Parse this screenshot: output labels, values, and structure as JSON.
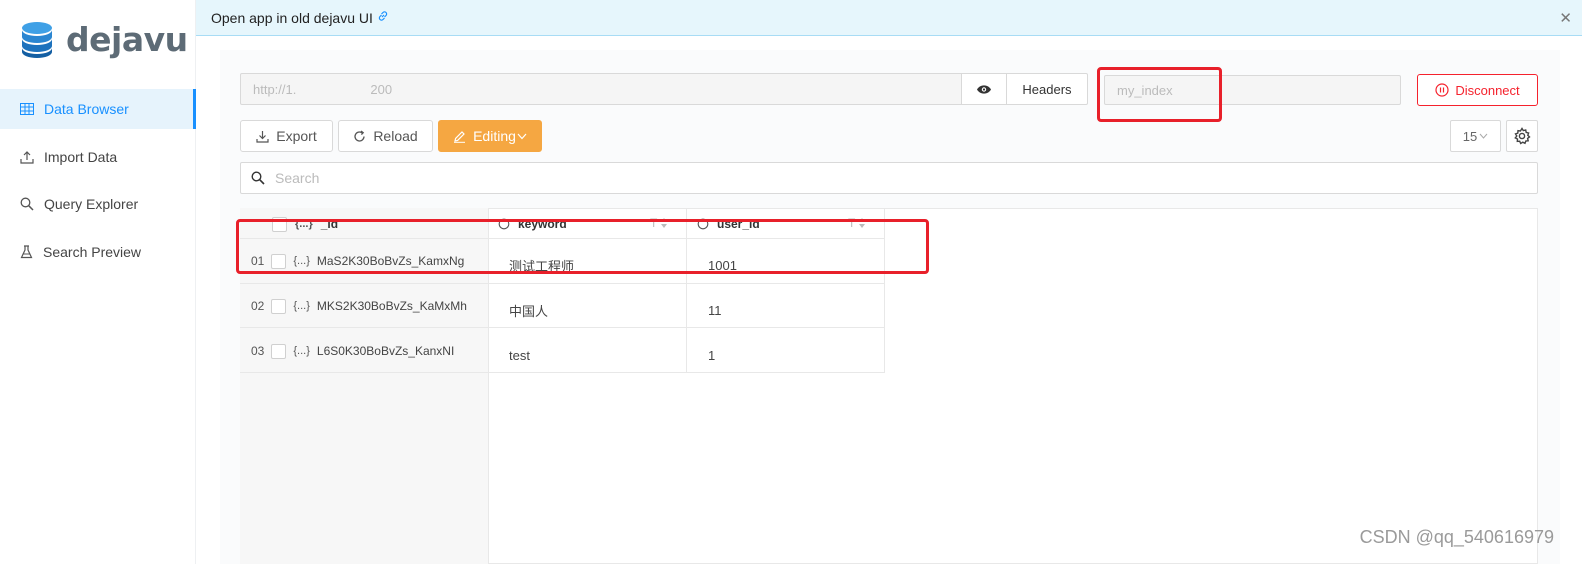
{
  "app": {
    "name": "dejavu"
  },
  "sidebar": {
    "items": [
      {
        "label": "Data Browser",
        "icon": "table-icon",
        "active": true
      },
      {
        "label": "Import Data",
        "icon": "upload-icon",
        "active": false
      },
      {
        "label": "Query Explorer",
        "icon": "search-icon",
        "active": false
      },
      {
        "label": "Search Preview",
        "icon": "flask-icon",
        "active": false
      }
    ]
  },
  "banner": {
    "text": "Open app in old dejavu UI",
    "link_icon": "link-icon",
    "close_icon": "close-icon"
  },
  "connection": {
    "url_prefix": "http://1.",
    "url_suffix": "200",
    "headers_label": "Headers",
    "index_placeholder": "my_index",
    "disconnect_label": "Disconnect"
  },
  "toolbar": {
    "export_label": "Export",
    "reload_label": "Reload",
    "editing_label": "Editing",
    "page_size": "15"
  },
  "search": {
    "placeholder": "Search"
  },
  "table": {
    "columns": [
      {
        "type": "{...}",
        "name": "_id"
      },
      {
        "name": "keyword"
      },
      {
        "name": "user_id"
      }
    ],
    "rows": [
      {
        "num": "01",
        "type": "{...}",
        "id": "MaS2K30BoBvZs_KamxNg",
        "keyword": "测试工程师",
        "user_id": "1001"
      },
      {
        "num": "02",
        "type": "{...}",
        "id": "MKS2K30BoBvZs_KaMxMh",
        "keyword": "中国人",
        "user_id": "11"
      },
      {
        "num": "03",
        "type": "{...}",
        "id": "L6S0K30BoBvZs_KanxNI",
        "keyword": "test",
        "user_id": "1"
      }
    ]
  },
  "watermark": "CSDN @qq_540616979",
  "colors": {
    "accent": "#1890ff",
    "editing": "#f5a742",
    "danger": "#f5222d",
    "annotation": "#e8202a"
  }
}
